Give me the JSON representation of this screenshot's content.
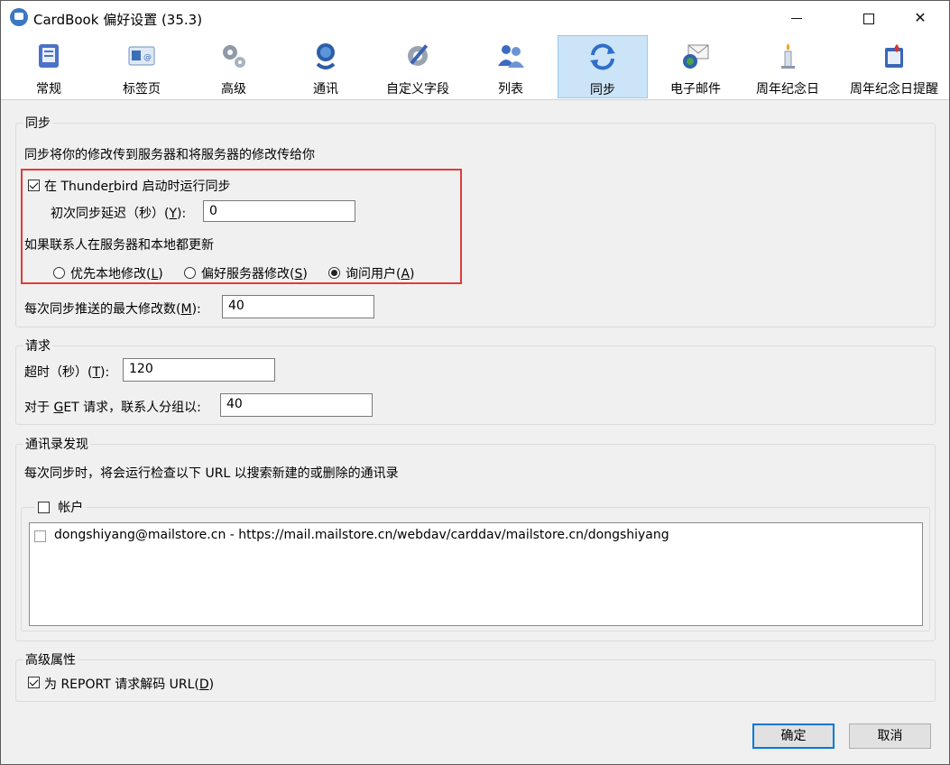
{
  "window": {
    "title": "CardBook 偏好设置 (35.3)"
  },
  "toolbar": {
    "tabs": [
      {
        "label": "常规"
      },
      {
        "label": "标签页"
      },
      {
        "label": "高级"
      },
      {
        "label": "通讯"
      },
      {
        "label": "自定义字段"
      },
      {
        "label": "列表"
      },
      {
        "label": "同步"
      },
      {
        "label": "电子邮件"
      },
      {
        "label": "周年纪念日"
      },
      {
        "label": "周年纪念日提醒"
      }
    ],
    "active": "同步"
  },
  "sync": {
    "legend": "同步",
    "description": "同步将你的修改传到服务器和将服务器的修改传给你",
    "startup_checkbox": {
      "label_pre": "在 Thunde",
      "label_key": "r",
      "label_post": "bird 启动时运行同步",
      "checked": true
    },
    "delay": {
      "label_pre": "初次同步延迟（秒）(",
      "label_key": "Y",
      "label_post": "):",
      "value": "0"
    },
    "conflict_label": "如果联系人在服务器和本地都更新",
    "radios": [
      {
        "label_pre": "优先本地修改(",
        "label_key": "L",
        "label_post": ")",
        "selected": false
      },
      {
        "label_pre": "偏好服务器修改(",
        "label_key": "S",
        "label_post": ")",
        "selected": false
      },
      {
        "label_pre": "询问用户(",
        "label_key": "A",
        "label_post": ")",
        "selected": true
      }
    ],
    "max_mods": {
      "label_pre": "每次同步推送的最大修改数(",
      "label_key": "M",
      "label_post": "):",
      "value": "40"
    }
  },
  "request": {
    "legend": "请求",
    "timeout": {
      "label_pre": "超时（秒）(",
      "label_key": "T",
      "label_post": "):",
      "value": "120"
    },
    "get_group": {
      "label_pre": "对于 ",
      "label_key": "G",
      "label_post": "ET 请求，联系人分组以:",
      "value": "40"
    }
  },
  "discovery": {
    "legend": "通讯录发现",
    "description": "每次同步时，将会运行检查以下 URL 以搜索新建的或删除的通讯录",
    "accounts_label": "帐户",
    "accounts": [
      {
        "text": "dongshiyang@mailstore.cn - https://mail.mailstore.cn/webdav/carddav/mailstore.cn/dongshiyang",
        "checked": false
      }
    ]
  },
  "advanced": {
    "legend": "高级属性",
    "decode_checkbox": {
      "label_pre": "为 REPORT 请求解码 URL(",
      "label_key": "D",
      "label_post": ")",
      "checked": true
    }
  },
  "buttons": {
    "ok": "确定",
    "cancel": "取消"
  }
}
